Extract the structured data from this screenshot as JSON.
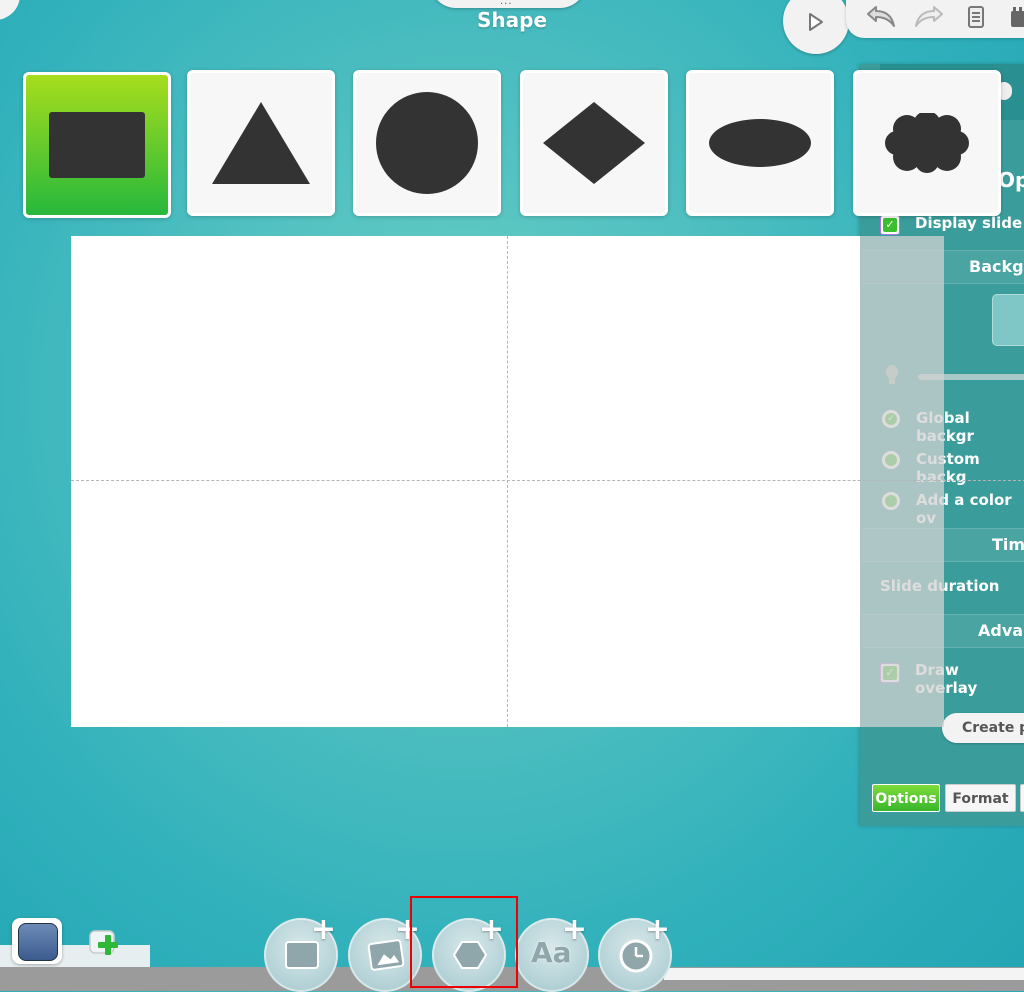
{
  "header": {
    "title": "Shape",
    "drag_dots": "..."
  },
  "toolbar": {
    "play_icon": "play-icon",
    "undo_icon": "undo-icon",
    "redo_icon": "redo-icon",
    "notes_icon": "notes-icon",
    "extra_icon": "tray-icon"
  },
  "shapes": [
    {
      "name": "rectangle",
      "selected": true
    },
    {
      "name": "triangle",
      "selected": false
    },
    {
      "name": "circle",
      "selected": false
    },
    {
      "name": "diamond",
      "selected": false
    },
    {
      "name": "ellipse",
      "selected": false
    },
    {
      "name": "cloud",
      "selected": false
    }
  ],
  "panel": {
    "title": "Opti",
    "display_slide": "Display slide",
    "background_header": "Backgr",
    "global_background": "Global backgr",
    "custom_background": "Custom backg",
    "color_overlay": "Add a color ov",
    "timing_header": "Timi",
    "slide_duration": "Slide duration",
    "advanced_header": "Advar",
    "draw_overlay": "Draw overlay",
    "create_button": "Create pl",
    "tabs": {
      "options": "Options",
      "format": "Format"
    }
  },
  "bottom": {
    "add_buttons": [
      "add-frame",
      "add-image",
      "add-shape",
      "add-text",
      "add-clock"
    ],
    "add_text_glyph": "Aa",
    "plus_glyph": "+"
  },
  "colors": {
    "accent_green": "#3bbf2f",
    "background_teal": "#4fbfc0",
    "shape_fill": "#333333",
    "highlight_red": "#e00000"
  }
}
